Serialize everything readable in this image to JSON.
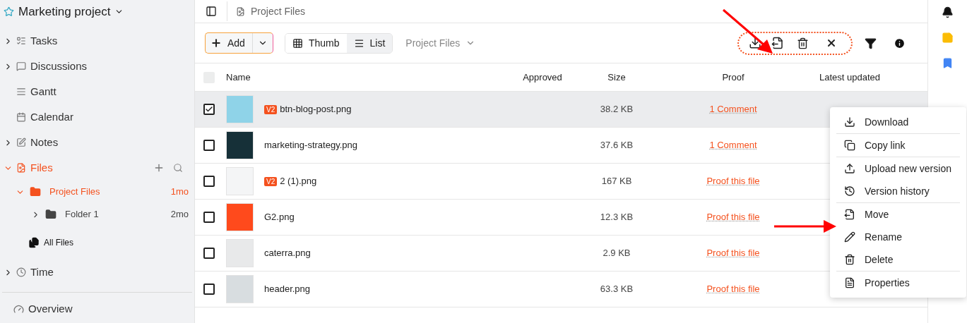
{
  "project": {
    "title": "Marketing project"
  },
  "sidebar": {
    "items": [
      {
        "label": "Tasks",
        "expandable": true,
        "expanded": false,
        "selected": false
      },
      {
        "label": "Discussions",
        "expandable": true,
        "expanded": false,
        "selected": false
      },
      {
        "label": "Gantt",
        "expandable": false,
        "selected": false
      },
      {
        "label": "Calendar",
        "expandable": false,
        "selected": false
      },
      {
        "label": "Notes",
        "expandable": true,
        "expanded": false,
        "selected": false
      },
      {
        "label": "Files",
        "expandable": true,
        "expanded": true,
        "selected": true,
        "children": [
          {
            "label": "Project Files",
            "time": "1mo",
            "expanded": true,
            "selected": true,
            "children": [
              {
                "label": "Folder 1",
                "time": "2mo",
                "expanded": false,
                "selected": false
              }
            ]
          }
        ],
        "footer": {
          "label": "All Files"
        }
      },
      {
        "label": "Time",
        "expandable": true,
        "expanded": false,
        "selected": false
      }
    ],
    "bottom": {
      "label": "Overview"
    }
  },
  "header": {
    "breadcrumb": "Project Files"
  },
  "toolbar": {
    "add": "Add",
    "views": [
      {
        "label": "Thumb",
        "selected": false
      },
      {
        "label": "List",
        "selected": true
      }
    ],
    "folder": "Project Files"
  },
  "table": {
    "select_all": {
      "checked": false
    },
    "columns": [
      "Name",
      "Approved",
      "Size",
      "Proof",
      "Latest updated"
    ],
    "rows": [
      {
        "checked": true,
        "badge": "V2",
        "name": "btn-blog-post.png",
        "size": "38.2 KB",
        "proof": "1 Comment"
      },
      {
        "checked": false,
        "name": "marketing-strategy.png",
        "size": "37.6 KB",
        "proof": "1 Comment"
      },
      {
        "checked": false,
        "badge": "V2",
        "name": "2 (1).png",
        "size": "167 KB",
        "proof": "Proof this file"
      },
      {
        "checked": false,
        "name": "G2.png",
        "size": "12.3 KB",
        "proof": "Proof this file"
      },
      {
        "checked": false,
        "name": "caterra.png",
        "size": "2.9 KB",
        "proof": "Proof this file"
      },
      {
        "checked": false,
        "name": "header.png",
        "size": "63.3 KB",
        "proof": "Proof this file"
      }
    ]
  },
  "context_menu": {
    "groups": [
      [
        "Download"
      ],
      [
        "Copy link"
      ],
      [
        "Upload new version",
        "Version history"
      ],
      [
        "Move",
        "Rename",
        "Delete"
      ],
      [
        "Properties"
      ]
    ]
  }
}
